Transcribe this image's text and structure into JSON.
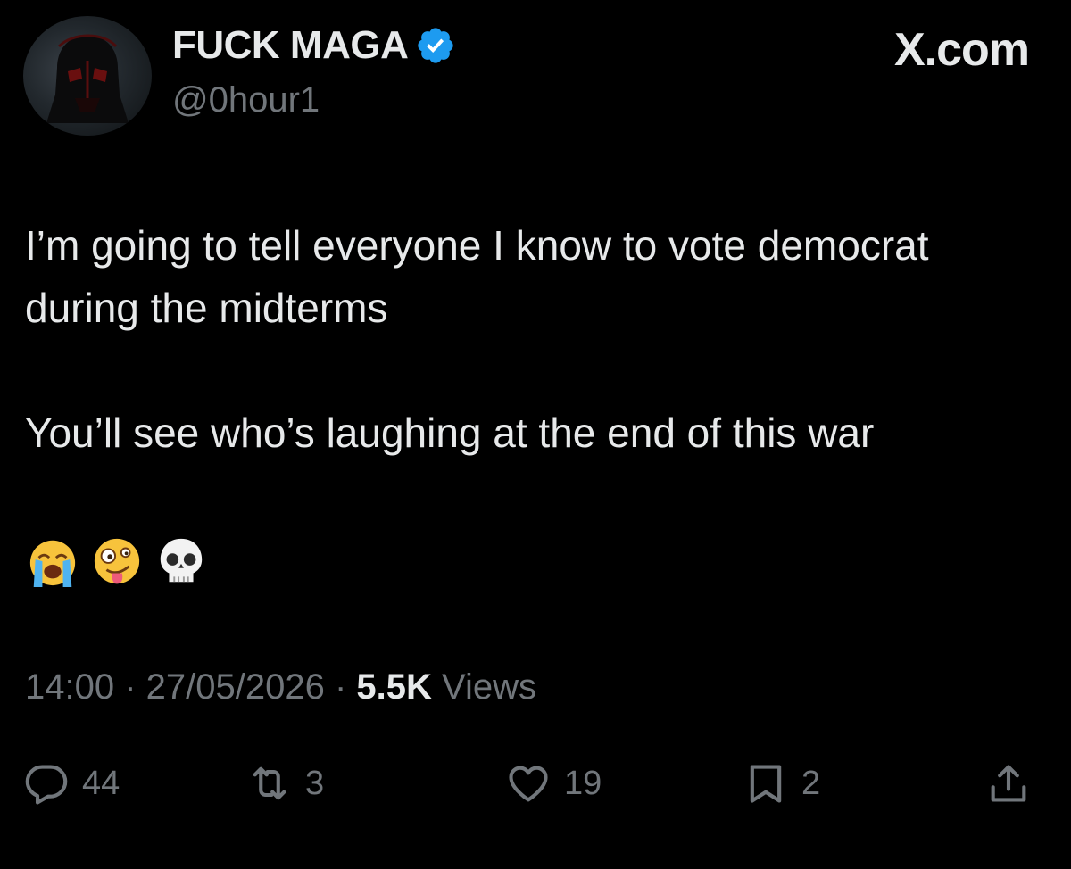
{
  "author": {
    "display_name": "FUCK MAGA",
    "handle": "@0hour1",
    "verified_icon": "verified-badge-icon",
    "avatar_icon": "helmet-avatar"
  },
  "brand": {
    "label": "X.com"
  },
  "tweet": {
    "paragraphs": [
      "I’m going to tell everyone I know to vote democrat during the midterms",
      "You’ll see who’s laughing at the end of this war"
    ],
    "emojis": [
      "loudly-crying-face",
      "zany-face",
      "skull"
    ]
  },
  "meta": {
    "time": "14:00",
    "separator": " · ",
    "date": "27/05/2026",
    "views_count": "5.5K",
    "views_label": " Views"
  },
  "actions": {
    "reply": {
      "icon": "reply-icon",
      "count": "44"
    },
    "repost": {
      "icon": "repost-icon",
      "count": "3"
    },
    "like": {
      "icon": "heart-icon",
      "count": "19"
    },
    "bookmark": {
      "icon": "bookmark-icon",
      "count": "2"
    },
    "share": {
      "icon": "share-icon"
    }
  },
  "colors": {
    "background": "#000000",
    "primary_text": "#e7e9ea",
    "secondary_text": "#71767b",
    "verified_blue": "#1d9bf0"
  }
}
